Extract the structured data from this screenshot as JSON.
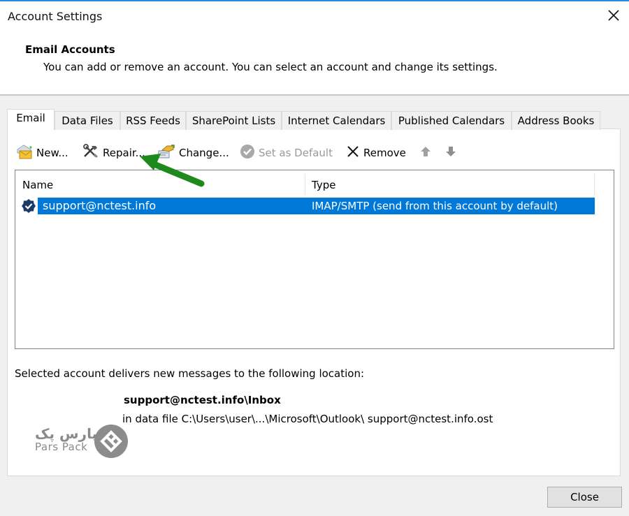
{
  "window": {
    "title": "Account Settings",
    "close_icon": "close-x-icon"
  },
  "header": {
    "section_title": "Email Accounts",
    "description": "You can add or remove an account. You can select an account and change its settings."
  },
  "tabs": [
    {
      "label": "Email",
      "active": true
    },
    {
      "label": "Data Files",
      "active": false
    },
    {
      "label": "RSS Feeds",
      "active": false
    },
    {
      "label": "SharePoint Lists",
      "active": false
    },
    {
      "label": "Internet Calendars",
      "active": false
    },
    {
      "label": "Published Calendars",
      "active": false
    },
    {
      "label": "Address Books",
      "active": false
    }
  ],
  "toolbar": {
    "new_label": "New...",
    "new_icon": "new-account-envelope-icon",
    "repair_label": "Repair...",
    "repair_icon": "tools-repair-icon",
    "change_label": "Change...",
    "change_icon": "change-account-icon",
    "set_default_label": "Set as Default",
    "set_default_icon": "check-circle-icon",
    "set_default_enabled": false,
    "remove_label": "Remove",
    "remove_icon": "x-remove-icon",
    "move_up_icon": "arrow-up-icon",
    "move_down_icon": "arrow-down-icon"
  },
  "accounts_list": {
    "columns": [
      "Name",
      "Type"
    ],
    "rows": [
      {
        "name": "support@nctest.info",
        "type": "IMAP/SMTP (send from this account by default)",
        "is_default": true,
        "selected": true
      }
    ]
  },
  "delivery": {
    "label": "Selected account delivers new messages to the following location:",
    "folder": "support@nctest.info\\Inbox",
    "data_file": "in data file C:\\Users\\user\\...\\Microsoft\\Outlook\\ support@nctest.info.ost"
  },
  "watermark": {
    "text_fa": "پارس پک",
    "text_en": "Pars Pack"
  },
  "annotation": {
    "arrow_color": "#1e8a1e",
    "points_to": "Repair..."
  },
  "footer": {
    "close_label": "Close"
  },
  "colors": {
    "selection": "#0078d7",
    "title_accent": "#2b88d8"
  }
}
